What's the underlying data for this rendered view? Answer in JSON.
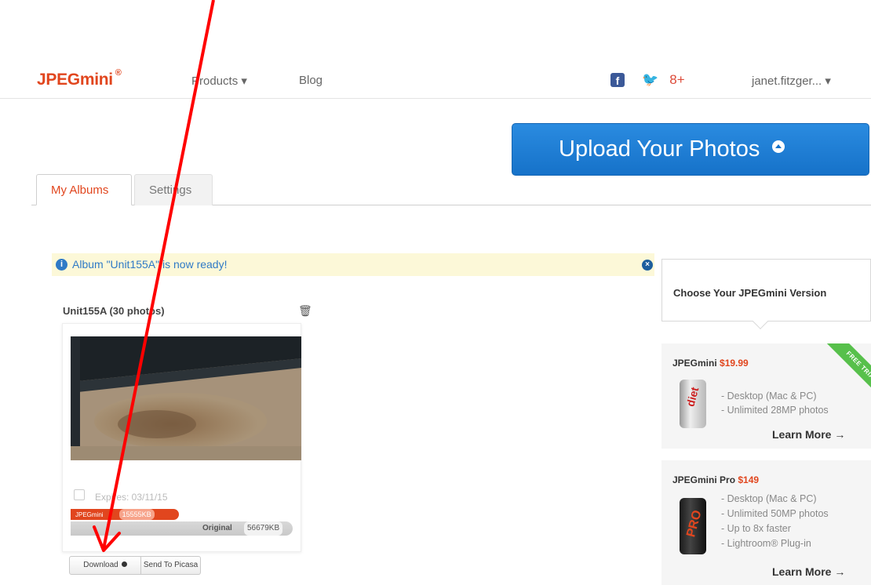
{
  "nav": {
    "logo": "JPEGmini",
    "logo_mark": "®",
    "products": "Products ▾",
    "blog": "Blog",
    "social": {
      "facebook": "f",
      "twitter": "🐦",
      "googleplus": "8+"
    },
    "user": "janet.fitzger... ▾"
  },
  "upload": {
    "label": "Upload Your Photos"
  },
  "tabs": {
    "my_albums": "My Albums",
    "settings": "Settings"
  },
  "notice": {
    "text": "Album \"Unit155A\" is now ready!",
    "info": "i",
    "close": "×"
  },
  "album": {
    "title": "Unit155A (30 photos)",
    "trash": "🗑",
    "expires": "Expires: 03/11/15",
    "brand": "JPEGmini",
    "saved": "15555KB",
    "original_label": "Original",
    "original_kb": "56679KB",
    "download": "Download",
    "send_picasa": "Send To Picasa"
  },
  "sidebar": {
    "choose_title": "Choose Your JPEGmini Version",
    "basic": {
      "name": "JPEGmini",
      "price": "$19.99",
      "ribbon": "FREE TRIAL",
      "features": [
        "- Desktop (Mac & PC)",
        "- Unlimited 28MP photos"
      ],
      "learn_more": "Learn More →",
      "can_label": "diet"
    },
    "pro": {
      "name": "JPEGmini Pro",
      "price": "$149",
      "features": [
        "- Desktop (Mac & PC)",
        "- Unlimited 50MP photos",
        "- Up to 8x faster",
        "- Lightroom® Plug-in"
      ],
      "learn_more": "Learn More →",
      "can_label": "PRO"
    }
  },
  "colors": {
    "brand": "#e1461e",
    "upload_blue": "#1f7fd6",
    "info_blue": "#2f7ac6",
    "notice_bg": "#fcf8d8",
    "ribbon_green": "#57c04b",
    "annotation_arrow": "#ff0000"
  }
}
